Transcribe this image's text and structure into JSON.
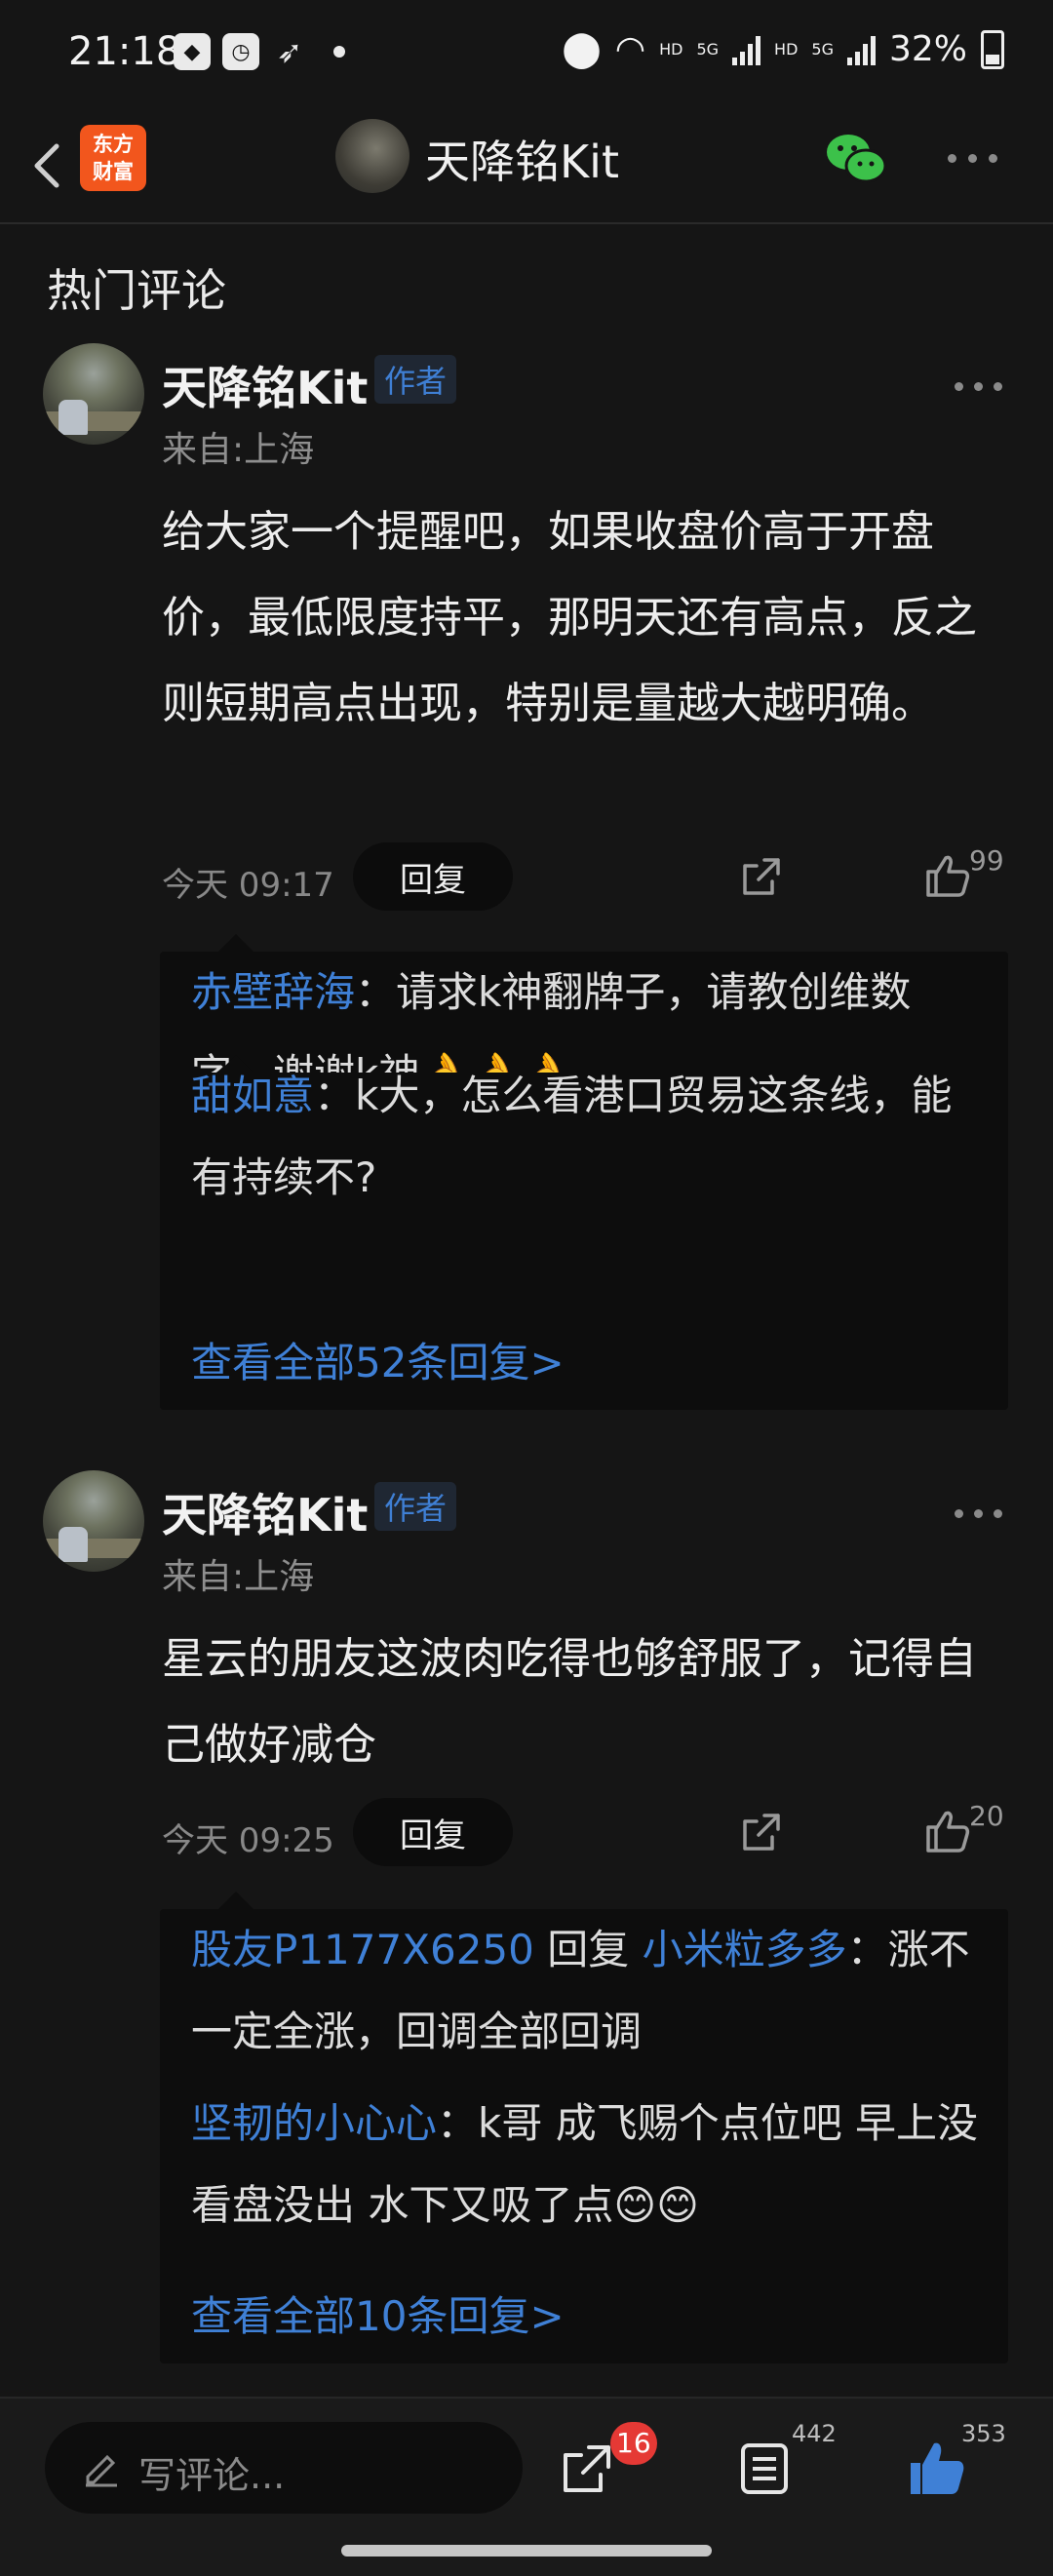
{
  "status_bar": {
    "time": "21:18",
    "hd1": "HD",
    "net1": "5G",
    "hd2": "HD",
    "net2": "5G",
    "battery": "32%"
  },
  "nav": {
    "logo_line1": "东方",
    "logo_line2": "财富",
    "title": "天降铭Kit"
  },
  "section_title": "热门评论",
  "comments": [
    {
      "name": "天降铭Kit",
      "badge": "作者",
      "location": "来自:上海",
      "text": "给大家一个提醒吧，如果收盘价高于开盘价，最低限度持平，那明天还有高点，反之则短期高点出现，特别是量越大越明确。",
      "time": "今天 09:17",
      "reply_label": "回复",
      "likes": "99",
      "replies": [
        {
          "user": "赤壁辞海",
          "sep": "：",
          "text": "请求k神翻牌子，请教创维数字，谢谢k神👌👌👌"
        },
        {
          "user": "甜如意",
          "sep": "：",
          "text": "k大，怎么看港口贸易这条线，能有持续不?"
        }
      ],
      "view_all": "查看全部52条回复>"
    },
    {
      "name": "天降铭Kit",
      "badge": "作者",
      "location": "来自:上海",
      "text": "星云的朋友这波肉吃得也够舒服了，记得自己做好减仓",
      "time": "今天 09:25",
      "reply_label": "回复",
      "likes": "20",
      "replies": [
        {
          "user": "股友P1177X6250",
          "mid": " 回复 ",
          "target": "小米粒多多",
          "sep": "：",
          "text": "涨不一定全涨，回调全部回调"
        },
        {
          "user": "坚韧的小心心",
          "sep": "：",
          "text": "k哥 成飞赐个点位吧 早上没看盘没出 水下又吸了点😊😊"
        }
      ],
      "view_all": "查看全部10条回复>"
    }
  ],
  "bottom_bar": {
    "placeholder": "写评论...",
    "share_badge": "16",
    "comment_count": "442",
    "like_count": "353"
  },
  "colors": {
    "accent_blue": "#3f80d6",
    "brand_orange": "#f2561d",
    "background": "#151515",
    "wechat_green": "#3cc14a"
  },
  "icons": [
    "back-icon",
    "wechat-icon",
    "more-icon",
    "share-icon",
    "like-icon",
    "pen-icon",
    "list-icon"
  ]
}
